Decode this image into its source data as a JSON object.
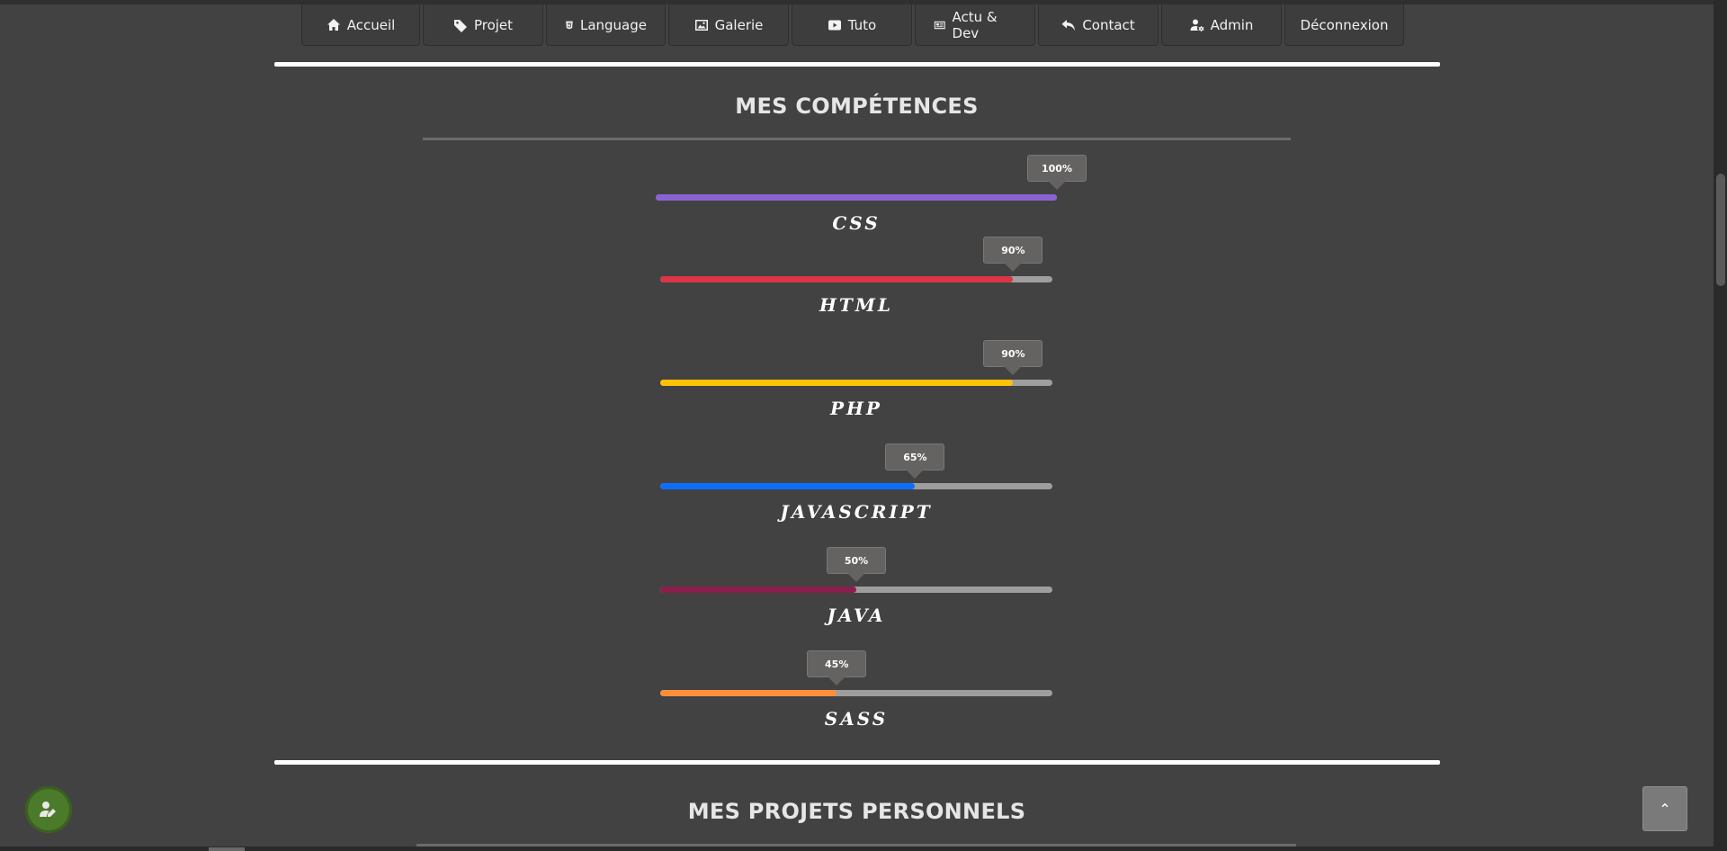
{
  "nav": {
    "items": [
      {
        "label": "Accueil",
        "icon": "home-icon"
      },
      {
        "label": "Projet",
        "icon": "tag-icon"
      },
      {
        "label": "Language",
        "icon": "html5-icon"
      },
      {
        "label": "Galerie",
        "icon": "image-icon"
      },
      {
        "label": "Tuto",
        "icon": "youtube-icon"
      },
      {
        "label": "Actu & Dev",
        "icon": "newspaper-icon"
      },
      {
        "label": "Contact",
        "icon": "reply-icon"
      },
      {
        "label": "Admin",
        "icon": "user-cog-icon"
      },
      {
        "label": "Déconnexion",
        "icon": ""
      }
    ]
  },
  "skills_section": {
    "title": "MES COMPÉTENCES",
    "skills": [
      {
        "name": "CSS",
        "percent_label": "100%",
        "value": 100,
        "color": "#8a63d2"
      },
      {
        "name": "HTML",
        "percent_label": "90%",
        "value": 90,
        "color": "#dc3545"
      },
      {
        "name": "PHP",
        "percent_label": "90%",
        "value": 90,
        "color": "#ffc107"
      },
      {
        "name": "JAVASCRIPT",
        "percent_label": "65%",
        "value": 65,
        "color": "#0d6efd"
      },
      {
        "name": "JAVA",
        "percent_label": "50%",
        "value": 50,
        "color": "#8b1e4a"
      },
      {
        "name": "SASS",
        "percent_label": "45%",
        "value": 45,
        "color": "#fd8f3c"
      }
    ]
  },
  "projects_section": {
    "title": "MES PROJETS PERSONNELS"
  },
  "floating": {
    "fab_icon": "user-edit-icon",
    "totop_icon": "chevron-up-icon",
    "totop_symbol": "⌃"
  }
}
